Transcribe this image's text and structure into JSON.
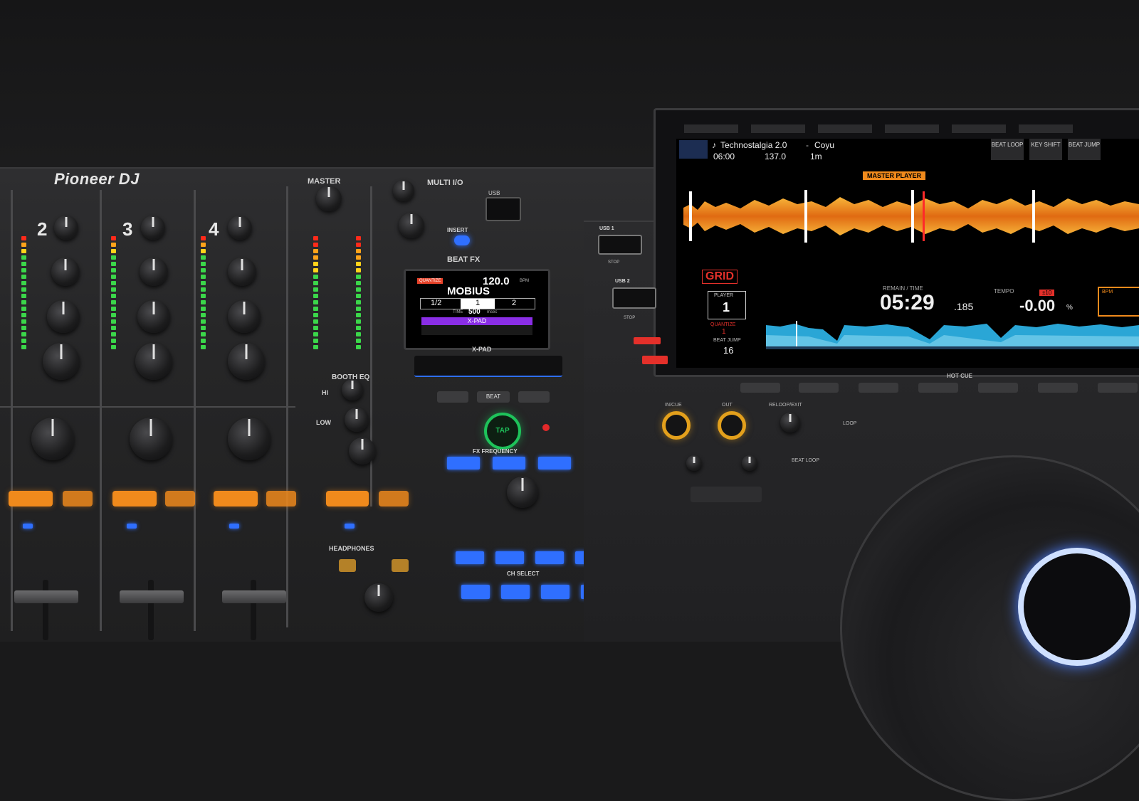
{
  "mixer": {
    "brand": "Pioneer DJ",
    "channels": [
      "2",
      "3",
      "4"
    ],
    "master_label": "MASTER",
    "multi_io_label": "MULTI I/O",
    "beat_fx_label": "BEAT FX",
    "insert_label": "INSERT",
    "usb_label": "USB",
    "booth_eq_label": "BOOTH EQ",
    "hi_label": "HI",
    "low_label": "LOW",
    "x_pad_label": "X-PAD",
    "fx_frequency_label": "FX FREQUENCY",
    "ch_select_label": "CH SELECT",
    "headphones_label": "HEADPHONES",
    "beat_label": "BEAT",
    "tap_label": "TAP",
    "fx_display": {
      "quantize": "QUANTIZE",
      "bpm": "120.0",
      "bpm_unit": "BPM",
      "effect": "MOBIUS",
      "beat_left": "1/2",
      "beat_center": "1",
      "beat_right": "2",
      "time_label": "TIME",
      "time_value": "500",
      "time_unit": "msec",
      "x_pad": "X-PAD"
    }
  },
  "cdj": {
    "track_title": "Technostalgia 2.0",
    "artist": "Coyu",
    "track_time": "06:00",
    "track_bpm": "137.0",
    "track_key": "1m",
    "header_buttons": [
      "BEAT LOOP",
      "KEY SHIFT",
      "BEAT JUMP"
    ],
    "master_player": "MASTER PLAYER",
    "grid_label": "GRID",
    "player_label": "PLAYER",
    "player_number": "1",
    "quantize_label": "QUANTIZE",
    "quantize_value": "1",
    "beat_jump_label": "BEAT JUMP",
    "beat_jump_value": "16",
    "remain_label": "REMAIN / TIME",
    "time_main": "05:29",
    "time_fraction": ".185",
    "tempo_label": "TEMPO",
    "tempo_badge": "±10",
    "tempo_value": "-0.00",
    "tempo_unit": "%",
    "bpm_label": "BPM",
    "usb1_label": "USB 1",
    "usb2_label": "USB 2",
    "stop_label": "STOP",
    "hot_cue_label": "HOT CUE",
    "in_cue_label": "IN/CUE",
    "out_label": "OUT",
    "reloop_label": "RELOOP/EXIT",
    "loop_label": "LOOP",
    "beat_loop_label": "BEAT LOOP",
    "colors": {
      "accent": "#f08a1c",
      "waveform_orange": "#e8820f",
      "waveform_blue": "#2aa6d6"
    }
  }
}
